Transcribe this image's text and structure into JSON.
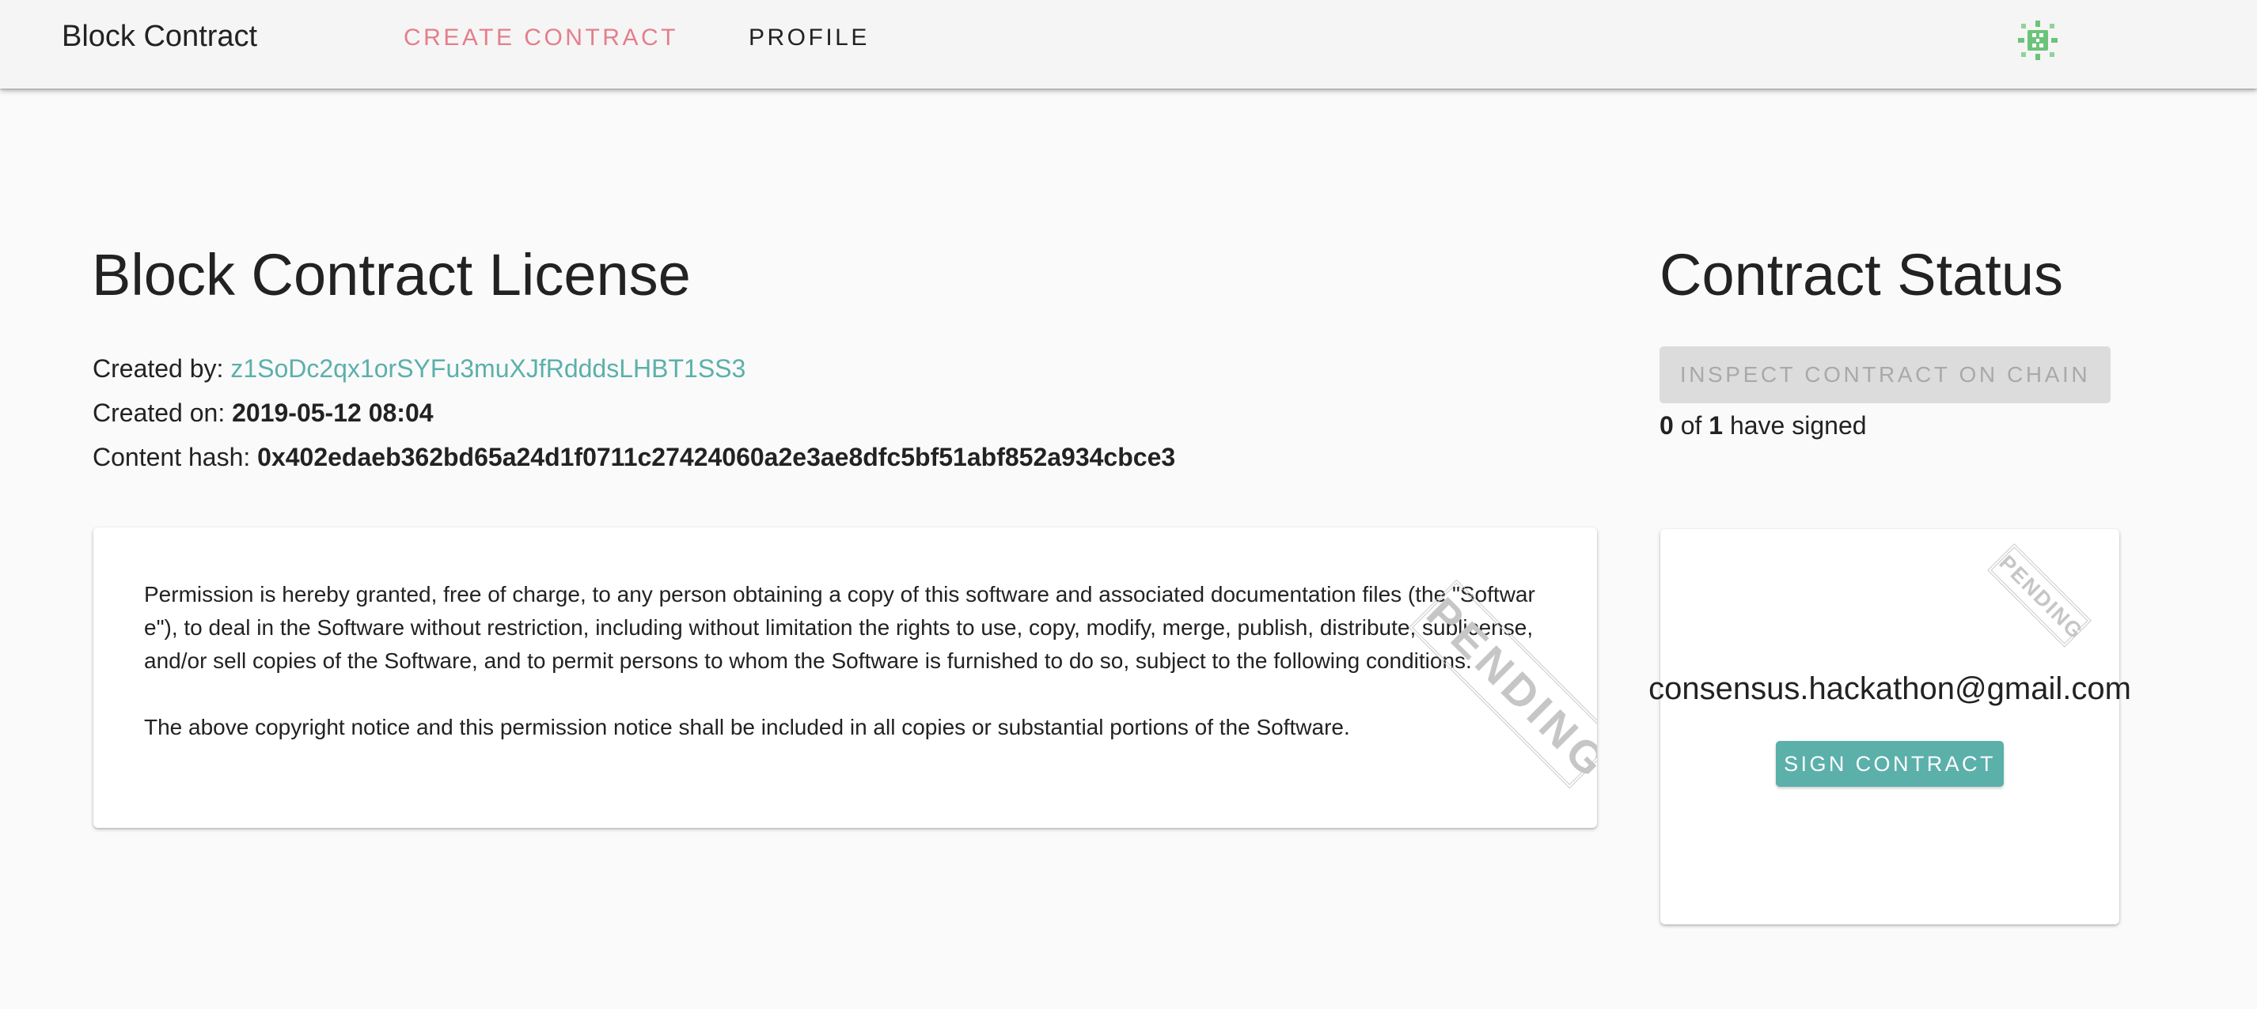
{
  "app": {
    "title": "Block Contract"
  },
  "nav": {
    "create_contract": "CREATE CONTRACT",
    "profile": "PROFILE",
    "avatar_icon": "identicon-avatar-icon"
  },
  "contract": {
    "title": "Block Contract License",
    "created_by_label": "Created by:",
    "created_by_value": "z1SoDc2qx1orSYFu3muXJfRdddsLHBT1SS3",
    "created_on_label": "Created on:",
    "created_on_value": "2019-05-12 08:04",
    "content_hash_label": "Content hash:",
    "content_hash_value": "0x402edaeb362bd65a24d1f0711c27424060a2e3ae8dfc5bf51abf852a934cbce3",
    "body": {
      "paragraph_1": "Permission is hereby granted, free of charge, to any person obtaining a copy of this software and associated documentation files (the \"Software\"), to deal in the Software without restriction, including without limitation the rights to use, copy, modify, merge, publish, distribute, sublicense, and/or sell copies of the Software, and to permit persons to whom the Software is furnished to do so, subject to the following conditions:",
      "paragraph_2": "The above copyright notice and this permission notice shall be included in all copies or substantial portions of the Software."
    },
    "stamp": "PENDING"
  },
  "status": {
    "title": "Contract Status",
    "inspect_button": "INSPECT CONTRACT ON CHAIN",
    "signed_count": "0",
    "of_label": "of",
    "total_count": "1",
    "have_signed_label": "have signed"
  },
  "signer": {
    "email": "consensus.hackathon@gmail.com",
    "stamp": "PENDING",
    "sign_button": "SIGN CONTRACT"
  },
  "colors": {
    "accent_teal": "#5bb0aa",
    "nav_active_pink": "#e57e8b",
    "identicon_green": "#6cc47a"
  }
}
